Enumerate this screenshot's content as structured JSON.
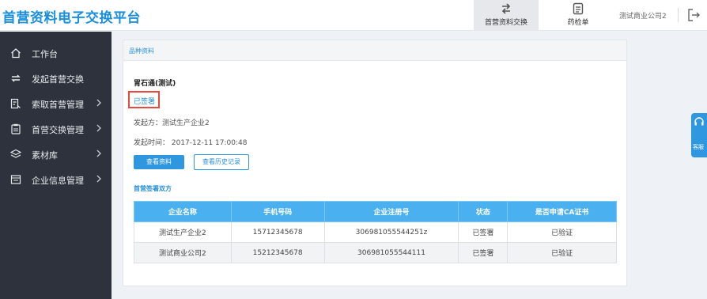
{
  "header": {
    "app_title": "首营资料电子交换平台",
    "tabs": [
      {
        "label": "首营资料交换",
        "icon": "exchange-icon",
        "active": true
      },
      {
        "label": "药检单",
        "icon": "document-icon",
        "active": false
      }
    ],
    "company": "测试商业公司2",
    "logout_icon": "logout-icon"
  },
  "sidebar": {
    "items": [
      {
        "label": "工作台",
        "icon": "home-icon",
        "has_arrow": false
      },
      {
        "label": "发起首营交换",
        "icon": "swap-icon",
        "has_arrow": false
      },
      {
        "label": "索取首营管理",
        "icon": "request-doc-icon",
        "has_arrow": true
      },
      {
        "label": "首营交换管理",
        "icon": "clipboard-icon",
        "has_arrow": true
      },
      {
        "label": "素材库",
        "icon": "layers-icon",
        "has_arrow": true
      },
      {
        "label": "企业信息管理",
        "icon": "building-icon",
        "has_arrow": true
      }
    ]
  },
  "main": {
    "panel_title": "品种资料",
    "product_name": "胃石通(测试)",
    "status": "已签署",
    "initiator": "发起方：测试生产企业2",
    "initiated_time": "发起时间：  2017-12-11 17:00:48",
    "view_button": "查看资料",
    "history_button": "查看历史记录",
    "parties_title": "首营签署双方",
    "table": {
      "headers": [
        "企业名称",
        "手机号码",
        "企业注册号",
        "状态",
        "是否申请CA证书"
      ],
      "rows": [
        [
          "测试生产企业2",
          "15712345678",
          "306981055544251z",
          "已签署",
          "已验证"
        ],
        [
          "测试商业公司2",
          "15212345678",
          "306981055544111",
          "已签署",
          "已验证"
        ]
      ]
    }
  },
  "service_tab": {
    "label": "客服",
    "icon": "headset-icon"
  },
  "colors": {
    "brand": "#1a8fdc",
    "sidebar": "#2d323c",
    "table_header": "#4bb0ef",
    "highlight_border": "#e8483d"
  }
}
